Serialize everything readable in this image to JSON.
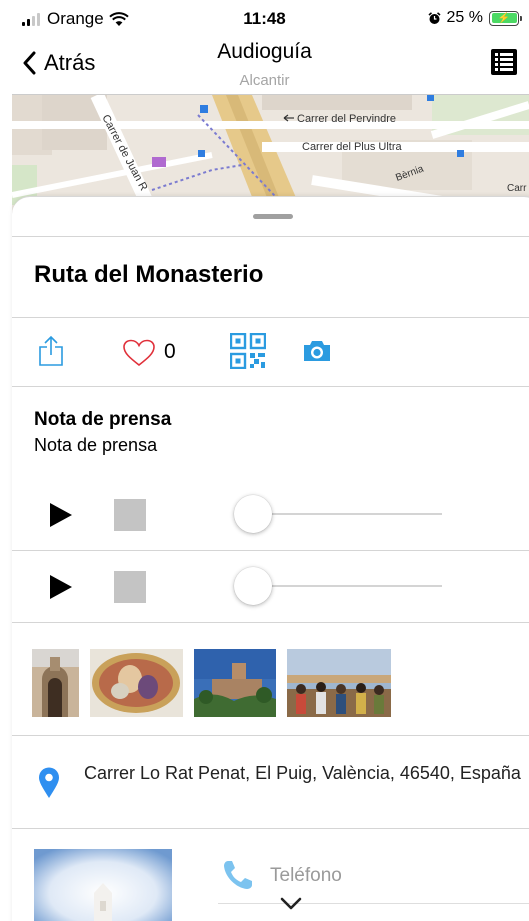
{
  "status_bar": {
    "carrier": "Orange",
    "time": "11:48",
    "battery_percent": "25 %",
    "battery_level": 0.25
  },
  "nav": {
    "back_label": "Atrás",
    "title": "Audioguía",
    "subtitle": "Alcantir",
    "menu_icon": "list-icon"
  },
  "map": {
    "street_labels": [
      "Carrer del Pervindre",
      "Carrer del Plus Ultra",
      "Carrer de Juan R",
      "Bèrnia",
      "Carr"
    ]
  },
  "route": {
    "title": "Ruta del Monasterio"
  },
  "actions": {
    "share_icon": "share-icon",
    "like_icon": "heart-icon",
    "like_count": "0",
    "qr_icon": "qr-code-icon",
    "camera_icon": "camera-icon"
  },
  "nota": {
    "title": "Nota de prensa",
    "subtitle": "Nota de prensa"
  },
  "players": [
    {
      "progress": 0
    },
    {
      "progress": 0
    }
  ],
  "gallery": [
    {
      "name": "monastery-portal-photo"
    },
    {
      "name": "fresco-oval-photo"
    },
    {
      "name": "monastery-tower-photo"
    },
    {
      "name": "group-visit-photo"
    }
  ],
  "address": {
    "icon": "location-pin-icon",
    "text": "Carrer Lo Rat Penat, El Puig, València, 46540, España"
  },
  "contact": {
    "phone_icon": "phone-icon",
    "phone_label": "Teléfono"
  },
  "colors": {
    "accent": "#2b9be0",
    "heart": "#e0303a",
    "pin": "#2f8ff0",
    "phone": "#7cc3ef",
    "battery": "#4cd964"
  }
}
